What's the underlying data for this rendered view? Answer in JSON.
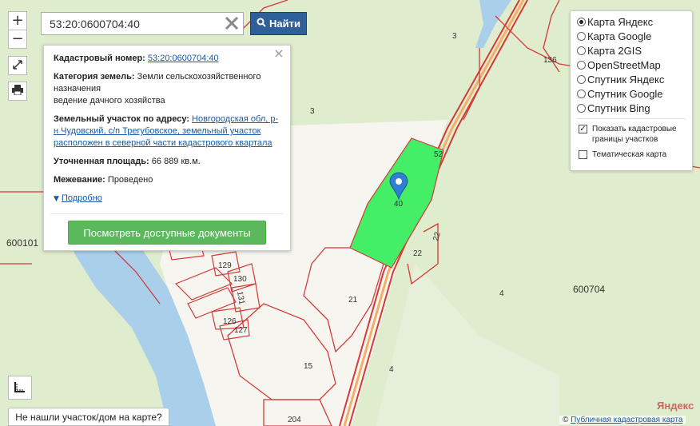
{
  "map": {
    "labels": {
      "p3a": "3",
      "p3b": "3",
      "p136": "136",
      "p600101": "600101",
      "p600704": "600704",
      "p4a": "4",
      "p4b": "4",
      "p21": "21",
      "p22a": "22",
      "p22b": "22",
      "p15": "15",
      "p204": "204",
      "p129": "129",
      "p130": "130",
      "p131": "131",
      "p126": "126",
      "p127": "127",
      "p40": "40",
      "p52": "52"
    }
  },
  "zoom": {
    "in": "+",
    "out": "−"
  },
  "search": {
    "value": "53:20:0600704:40",
    "find_label": "Найти"
  },
  "popup": {
    "cadastral_label": "Кадастровый номер:",
    "cadastral_value": "53:20:0600704:40",
    "category_label": "Категория земель:",
    "category_value": "Земли сельскохозяйственного назначения",
    "usage": "ведение дачного хозяйства",
    "address_label": "Земельный участок по адресу:",
    "address_value": "Новгородская обл, р-н Чудовский, с/п Трегубовское, земельный участок расположен в северной части кадастрового квартала",
    "area_label": "Уточненная площадь:",
    "area_value": "66 889 кв.м.",
    "survey_label": "Межевание:",
    "survey_value": "Проведено",
    "more_label": "Подробно",
    "docs_button": "Посмотреть доступные документы",
    "close": "×"
  },
  "layers": {
    "options": [
      {
        "label": "Карта Яндекс",
        "checked": true
      },
      {
        "label": "Карта Google",
        "checked": false
      },
      {
        "label": "Карта 2GIS",
        "checked": false
      },
      {
        "label": "OpenStreetMap",
        "checked": false
      },
      {
        "label": "Спутник Яндекс",
        "checked": false
      },
      {
        "label": "Спутник Google",
        "checked": false
      },
      {
        "label": "Спутник Bing",
        "checked": false
      }
    ],
    "show_borders": "Показать кадастровые границы участков",
    "thematic": "Тематическая карта"
  },
  "bottom": {
    "not_found": "Не нашли участок/дом на карте?",
    "yandex": "Яндекс",
    "copyright_symbol": "©",
    "copyright_link": "Публичная кадастровая карта"
  },
  "colors": {
    "forest": "#dfeccd",
    "field": "#f5f4ee",
    "river": "#a9cfea",
    "boundary": "#d33a3a",
    "selected": "#44ee66",
    "accent": "#2f5f98",
    "docs_button": "#5cb85c"
  },
  "icons": [
    "fullscreen-icon",
    "print-icon",
    "search-icon",
    "clear-icon",
    "map-marker-icon",
    "ruler-icon",
    "caret-down-icon"
  ]
}
